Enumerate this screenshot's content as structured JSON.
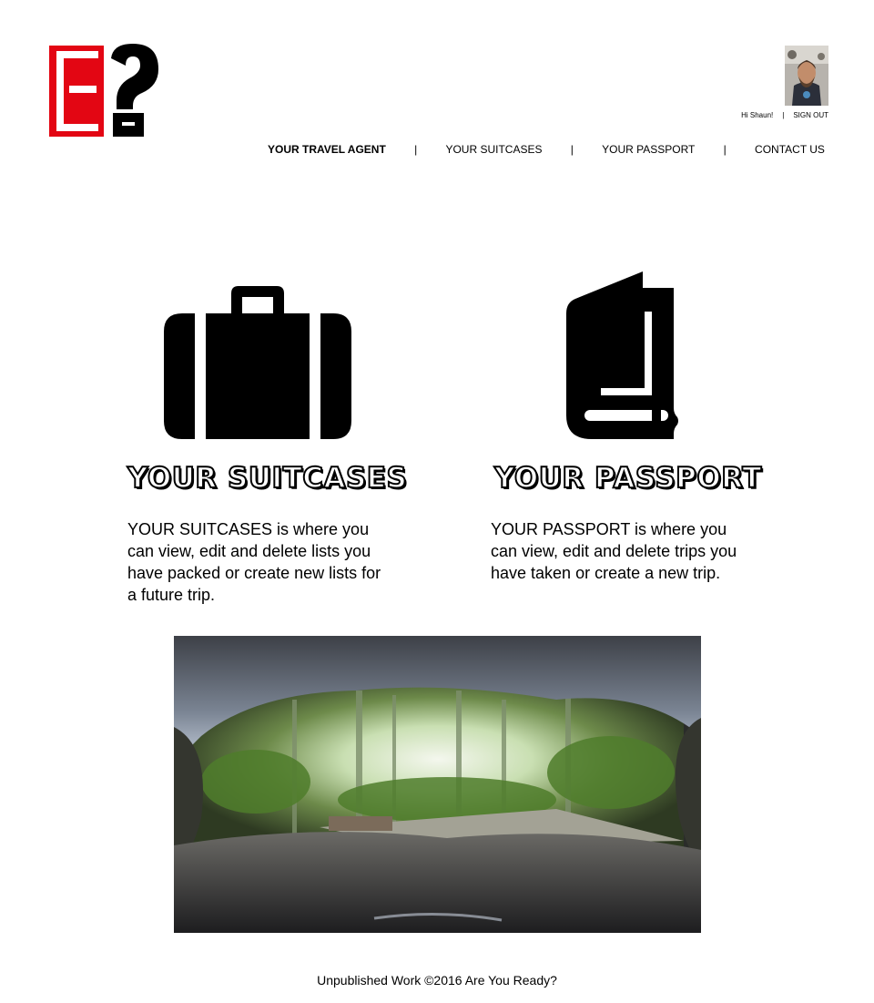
{
  "brand": {
    "logo_letter": "E",
    "logo_mark": "?",
    "colors": {
      "red": "#e30613",
      "black": "#000000"
    }
  },
  "user": {
    "greeting": "Hi Shaun!",
    "separator": "|",
    "sign_out": "SIGN OUT",
    "avatar_icon": "user-avatar"
  },
  "nav": {
    "separator": "|",
    "items": [
      {
        "label": "YOUR TRAVEL AGENT",
        "active": true
      },
      {
        "label": "YOUR SUITCASES"
      },
      {
        "label": "YOUR PASSPORT"
      },
      {
        "label": "CONTACT US"
      }
    ]
  },
  "features": [
    {
      "icon": "suitcase-icon",
      "heading": "YOUR SUITCASES",
      "description": "YOUR SUITCASES is where you can view, edit and delete lists you have packed or create new lists for a future trip."
    },
    {
      "icon": "passport-book-icon",
      "heading": "YOUR PASSPORT",
      "description": "YOUR PASSPORT is where you can view, edit and delete trips you have taken or create a new trip."
    }
  ],
  "hero": {
    "image": "cave-opening-forest-photo"
  },
  "footer": {
    "text": "Unpublished Work ©2016 Are You Ready?"
  }
}
